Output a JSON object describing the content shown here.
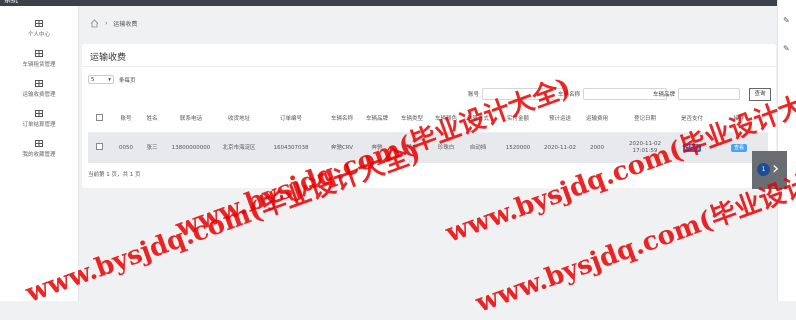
{
  "window": {
    "title": "系统"
  },
  "sidebar": {
    "items": [
      {
        "label": "个人中心",
        "icon": "table-icon"
      },
      {
        "label": "车辆租赁管理",
        "icon": "table-icon"
      },
      {
        "label": "运输收费管理",
        "icon": "table-icon"
      },
      {
        "label": "订单结算管理",
        "icon": "table-icon"
      },
      {
        "label": "我的收藏管理",
        "icon": "table-icon"
      }
    ]
  },
  "breadcrumb": {
    "home_icon": "home-icon",
    "current": "运输收费"
  },
  "panel": {
    "title": "运输收费"
  },
  "pagination_top": {
    "size": "5",
    "suffix": "条每页"
  },
  "filters": [
    {
      "label": "账号"
    },
    {
      "label": "车辆名称"
    },
    {
      "label": "车辆品牌"
    }
  ],
  "search_button": "查询",
  "table": {
    "headers": [
      "",
      "账号",
      "姓名",
      "联系电话",
      "收货地址",
      "订单编号",
      "车辆名称",
      "车辆品牌",
      "车辆类型",
      "车辆颜色",
      "结算方式",
      "实付金额",
      "预计运送",
      "运输费用",
      "登记日期",
      "是否支付",
      "操作"
    ],
    "rows": [
      {
        "cells": [
          "",
          "0050",
          "张三",
          "13800000000",
          "北京市海淀区",
          "1604307038",
          "奔驰CRV",
          "奔驰",
          "轿车",
          "珍珠白",
          "自动挡",
          "1520000",
          "2020-11-02",
          "2000",
          "2020-11-02 17:01:59",
          "已支付",
          "查看"
        ]
      }
    ]
  },
  "footer": "当前第 1 页，共 1 页",
  "next_button": {
    "page": "1"
  },
  "watermarks": [
    "www.bysjdq.com(毕业设计大全)",
    "www.bysjdq.com(毕业设计大全)",
    "www.bysjdq.com(毕业设计大全)",
    "www.bysjdq.com(毕业设计大全)"
  ],
  "colors": {
    "primary_button": "#2f6fc9",
    "secondary_button": "#4aa3f0",
    "watermark": "#e60000",
    "header_dark": "#3c4048"
  }
}
